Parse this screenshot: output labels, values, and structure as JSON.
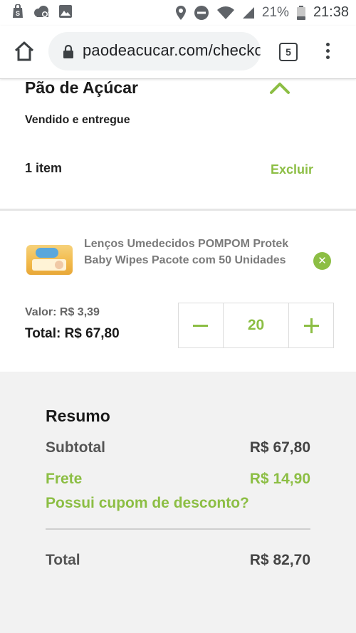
{
  "status_bar": {
    "battery_percent": "21%",
    "time": "21:38",
    "icons": [
      "shopping-icon",
      "cloud-icon",
      "image-icon",
      "location-icon",
      "dnd-icon",
      "wifi-icon",
      "signal-icon",
      "battery-icon"
    ]
  },
  "browser": {
    "url": "paodeacucar.com/checkout",
    "tab_count": "5"
  },
  "store": {
    "name": "Pão de Açúcar",
    "sold_by": "Vendido e entregue",
    "item_count": "1 item",
    "remove_all_label": "Excluir"
  },
  "product": {
    "name": "Lenços Umedecidos POMPOM Protek Baby Wipes Pacote com 50 Unidades",
    "unit_price": "Valor: R$ 3,39",
    "total": "Total: R$ 67,80",
    "quantity": "20"
  },
  "summary": {
    "title": "Resumo",
    "subtotal_label": "Subtotal",
    "subtotal_value": "R$ 67,80",
    "frete_label": "Frete",
    "frete_value": "R$ 14,90",
    "coupon_link": "Possui cupom de desconto?",
    "total_label": "Total",
    "total_value": "R$ 82,70"
  },
  "colors": {
    "accent": "#8cbe44",
    "summary_bg": "#f2f2f2"
  }
}
